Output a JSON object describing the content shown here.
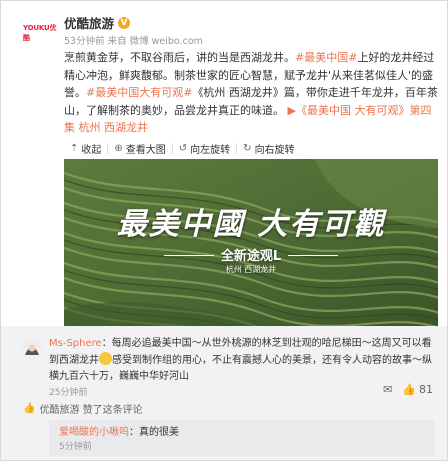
{
  "post": {
    "avatar_logo": "YOUKU优酷",
    "username": "优酷旅游",
    "verified_icon": "v-badge-icon",
    "meta": "53分钟前 来自 微博 weibo.com",
    "text_1": "烹煎黄金芽，不取谷雨后，讲的当是西湖龙井。",
    "tag_1": "#最美中国#",
    "text_2": "上好的龙井经过精心冲泡，鲜爽馥郁。制茶世家的匠心智慧，赋予龙井'从来佳茗似佳人'的盛誉。",
    "tag_2": "#最美中国大有可观#",
    "text_3": "《杭州 西湖龙井》篇，带你走进千年龙井，百年茶山，了解制茶的奥妙，品尝龙井真正的味道。",
    "link": "《最美中国 大有可观》第四集 杭州 西湖龙井",
    "link_icon": "video-link-icon"
  },
  "toolbar": {
    "collapse": "收起",
    "view_large": "查看大图",
    "rotate_left": "向左旋转",
    "rotate_right": "向右旋转"
  },
  "video": {
    "title": "最美中國 大有可觀",
    "subtitle": "全新途观L",
    "location": "杭州 西湖龙井"
  },
  "comment": {
    "user": "Ms-Sphere",
    "text_a": "：每周必追最美中国～从世外桃源的林芝到壮观的哈尼梯田～这周又可以看到西湖龙井",
    "text_b": "感受到制作组的用心，不止有震撼人心的美景，还有令人动容的故事～纵横九百六十万，巍巍中华好河山",
    "time": "25分钟前",
    "like_count": "81",
    "liked_by": "优酷旅游 赞了这条评论"
  },
  "reply": {
    "user": "爱喝酸的小啾呜",
    "text": "：真的很美",
    "time": "5分钟前"
  },
  "colors": {
    "accent": "#eb7350",
    "verified": "#f5a623",
    "brand_red": "#e6233e"
  }
}
